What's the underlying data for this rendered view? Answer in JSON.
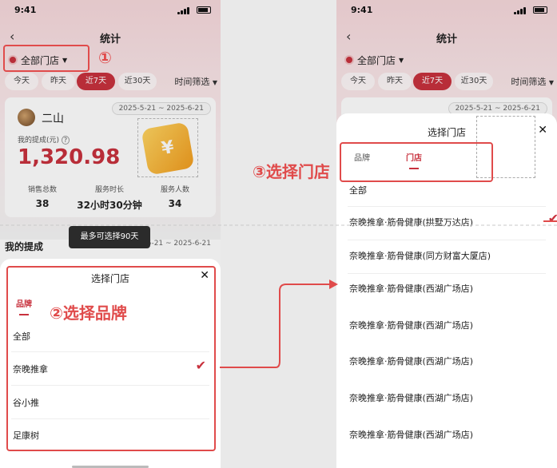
{
  "left_phone": {
    "status_time": "9:41",
    "nav_title": "统计",
    "store_selector": "全部门店",
    "date_tabs": [
      "今天",
      "昨天",
      "近7天",
      "近30天"
    ],
    "active_tab_index": 2,
    "time_filter": "时间筛选",
    "card": {
      "date_range": "2025-5-21 ~ 2025-6-21",
      "user_name": "二山",
      "commission_label": "我的提成(元)",
      "commission_value": "1,320.98",
      "wallet_symbol": "¥",
      "stats": [
        {
          "label": "销售总数",
          "value": "38"
        },
        {
          "label": "服务时长",
          "value": "32小时30分钟"
        },
        {
          "label": "服务人数",
          "value": "34"
        }
      ]
    },
    "section2_title": "我的提成",
    "section2_range": "2025-5-21 ~ 2025-6-21",
    "toast": "最多可选择90天",
    "sheet": {
      "title": "选择门店",
      "tab_brand": "品牌",
      "options": [
        "全部",
        "奈晚推拿",
        "谷小推",
        "足康树"
      ],
      "checked_index": 1
    }
  },
  "right_phone": {
    "status_time": "9:41",
    "nav_title": "统计",
    "store_selector": "全部门店",
    "date_tabs": [
      "今天",
      "昨天",
      "近7天",
      "近30天"
    ],
    "time_filter": "时间筛选",
    "date_range": "2025-5-21 ~ 2025-6-21",
    "sheet": {
      "title": "选择门店",
      "tab_brand": "品牌",
      "tab_store": "门店",
      "options": [
        "全部",
        "奈晚推拿·筋骨健康(拱墅万达店)",
        "奈晚推拿·筋骨健康(同方财富大厦店)",
        "奈晚推拿·筋骨健康(西湖广场店)",
        "奈晚推拿·筋骨健康(西湖广场店)",
        "奈晚推拿·筋骨健康(西湖广场店)",
        "奈晚推拿·筋骨健康(西湖广场店)",
        "奈晚推拿·筋骨健康(西湖广场店)"
      ],
      "checked_index": 1
    }
  },
  "annotations": {
    "step1": "①",
    "step2": "②选择品牌",
    "step3": "③选择门店",
    "accent_color": "#e04b4b"
  }
}
